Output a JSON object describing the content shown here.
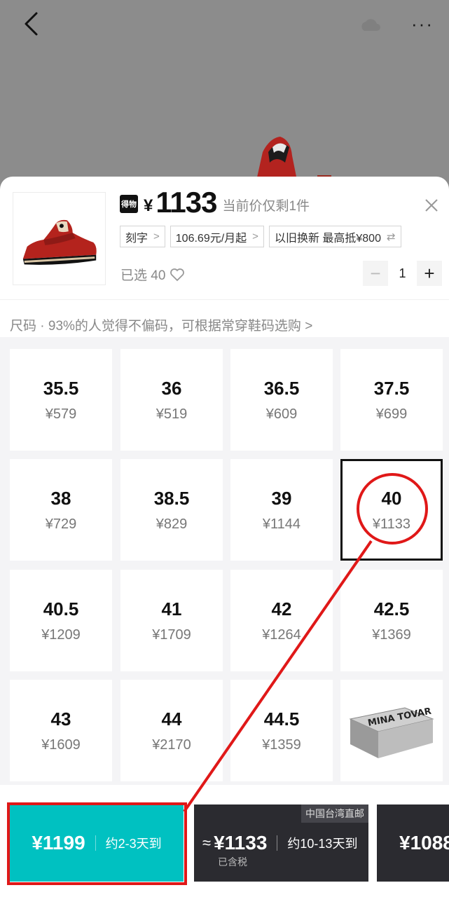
{
  "header": {
    "back_icon": "chevron-left-icon",
    "more_icon": "ellipsis-icon",
    "more_label": "···"
  },
  "product": {
    "brand_icon_text": "得物",
    "currency": "¥",
    "price": "1133",
    "price_note": "当前价仅剩1件",
    "tags": [
      {
        "label": "刻字"
      },
      {
        "label": "106.69元/月起"
      },
      {
        "label": "以旧换新 最高抵¥800"
      }
    ],
    "selected_label": "已选 40",
    "quantity": "1"
  },
  "size_hint": "尺码 · 93%的人觉得不偏码，可根据常穿鞋码选购 >",
  "sizes": [
    {
      "size": "35.5",
      "price": "¥579"
    },
    {
      "size": "36",
      "price": "¥519"
    },
    {
      "size": "36.5",
      "price": "¥609"
    },
    {
      "size": "37.5",
      "price": "¥699"
    },
    {
      "size": "38",
      "price": "¥729"
    },
    {
      "size": "38.5",
      "price": "¥829"
    },
    {
      "size": "39",
      "price": "¥1144"
    },
    {
      "size": "40",
      "price": "¥1133"
    },
    {
      "size": "40.5",
      "price": "¥1209"
    },
    {
      "size": "41",
      "price": "¥1709"
    },
    {
      "size": "42",
      "price": "¥1264"
    },
    {
      "size": "42.5",
      "price": "¥1369"
    },
    {
      "size": "43",
      "price": "¥1609"
    },
    {
      "size": "44",
      "price": "¥2170"
    },
    {
      "size": "44.5",
      "price": "¥1359"
    }
  ],
  "selected_size": "40",
  "box_logo_text": "MINA TOVAR",
  "purchase_options": [
    {
      "price": "¥1199",
      "delivery": "约2-3天到"
    },
    {
      "approx": "≈",
      "price": "¥1133",
      "delivery": "约10-13天到",
      "tax": "已含税",
      "badge": "中国台湾直邮"
    },
    {
      "price": "¥1088"
    }
  ],
  "colors": {
    "teal": "#00c1c1",
    "dark": "#2b2b30",
    "annotation_red": "#e01818"
  }
}
